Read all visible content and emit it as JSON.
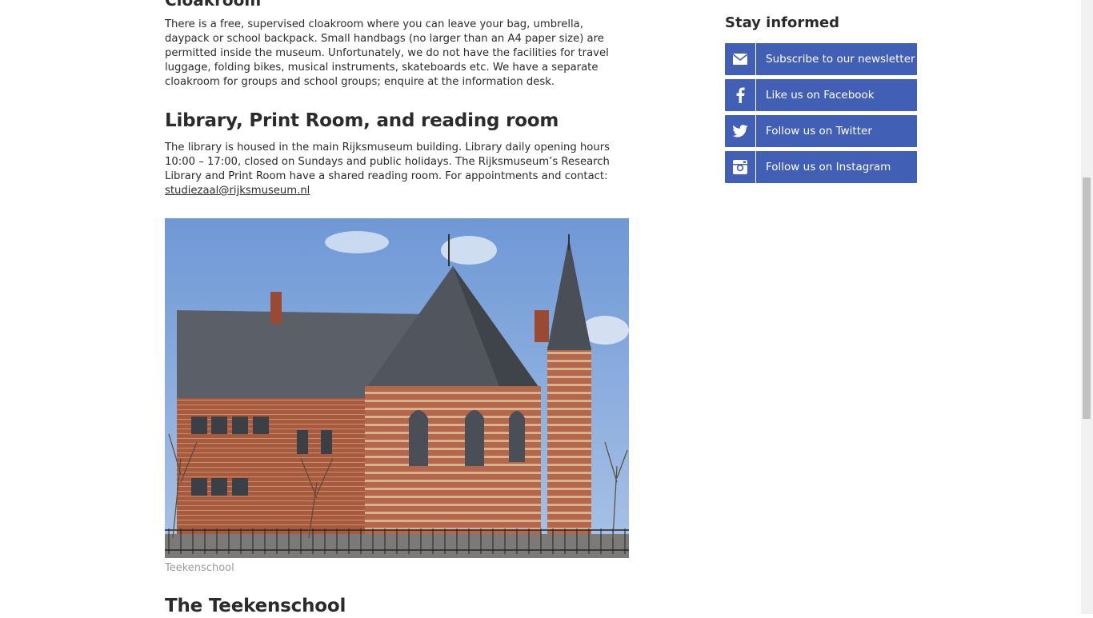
{
  "cloakroom": {
    "heading": "Cloakroom",
    "text": "There is a free, supervised cloakroom where you can leave your bag, umbrella, daypack or school backpack. Small handbags (no larger than an A4 paper size) are permitted inside the museum. Unfortunately, we do not have the facilities for travel luggage, folding bikes, musical instruments, skateboards etc. We have a separate cloakroom for groups and school groups; enquire at the information desk."
  },
  "library": {
    "heading": "Library, Print Room, and reading room",
    "text": "The library is housed in the main Rijksmuseum building. Library daily opening hours 10:00 – 17:00, closed on Sundays and public holidays. The Rijksmuseum’s Research Library and Print Room have a shared reading room. For appointments and contact:",
    "email": "studiezaal@rijksmuseum.nl"
  },
  "image": {
    "caption": "Teekenschool"
  },
  "teekenschool": {
    "heading": "The Teekenschool"
  },
  "sidebar": {
    "title": "Stay informed",
    "accent": "#415fb5",
    "buttons": [
      {
        "label": "Subscribe to our newsletter",
        "icon": "envelope-icon"
      },
      {
        "label": "Like us on Facebook",
        "icon": "facebook-icon"
      },
      {
        "label": "Follow us on Twitter",
        "icon": "twitter-icon"
      },
      {
        "label": "Follow us on Instagram",
        "icon": "instagram-icon"
      }
    ]
  }
}
